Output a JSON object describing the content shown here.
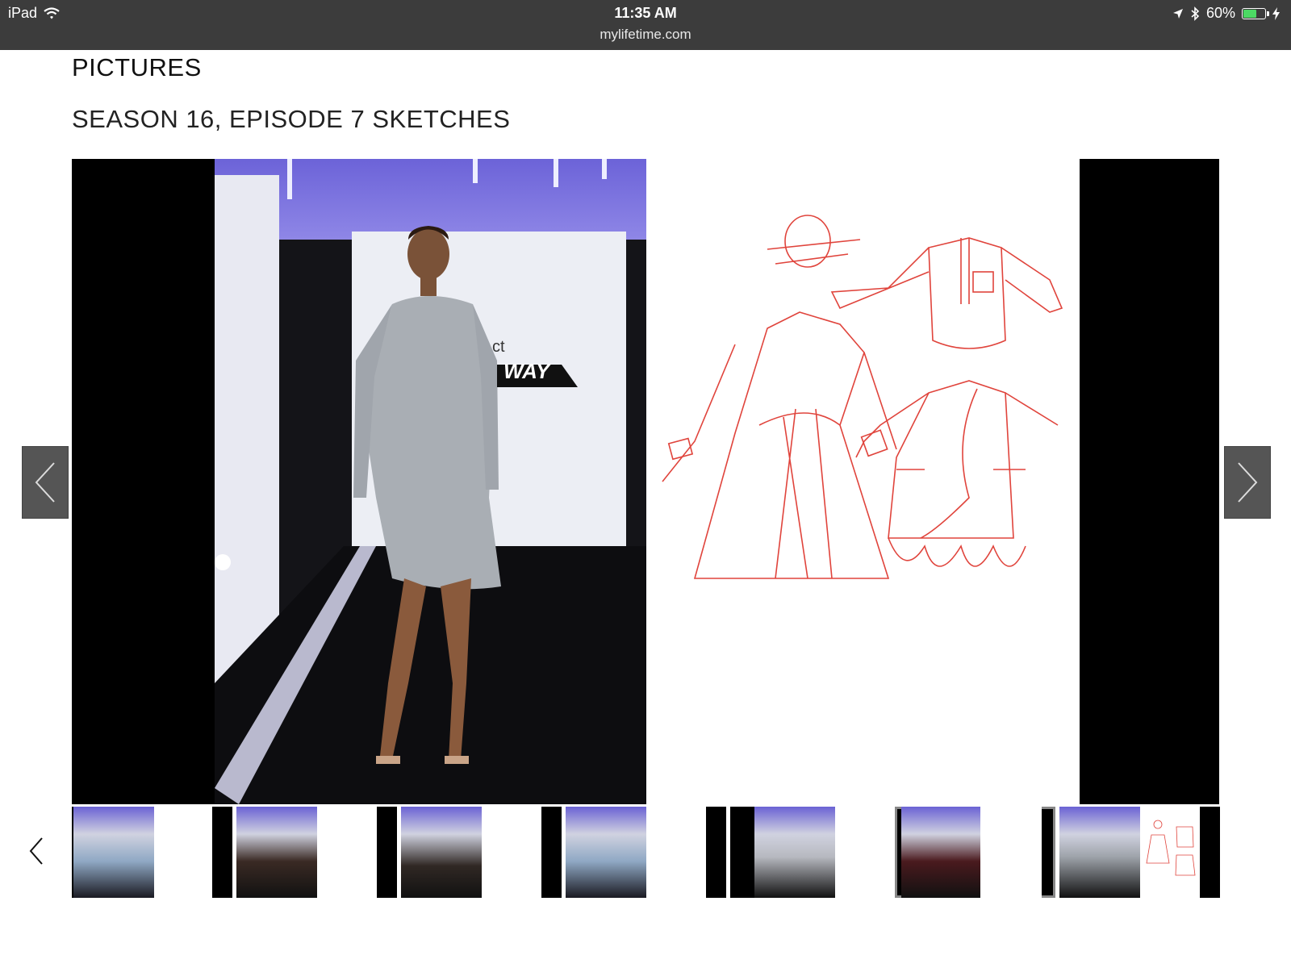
{
  "status_bar": {
    "device": "iPad",
    "time": "11:35 AM",
    "url": "mylifetime.com",
    "battery": "60%",
    "battery_level": 0.6,
    "icons": [
      "wifi-icon",
      "location-arrow-icon",
      "bluetooth-icon",
      "battery-icon",
      "charging-icon"
    ]
  },
  "page": {
    "heading": "PICTURES",
    "subheading": "SEASON 16, EPISODE 7 SKETCHES"
  },
  "viewer": {
    "backdrop_sign": "WAY",
    "backdrop_sign_small": "ct",
    "prev_icon": "chevron-left-icon",
    "next_icon": "chevron-right-icon"
  },
  "thumbnails": {
    "prev_icon": "chevron-left-icon",
    "count": 7,
    "active_index": 5
  },
  "colors": {
    "status_bar_bg": "#3c3c3c",
    "battery_green": "#4cd964",
    "sketch_red": "#e0443c",
    "nav_button_bg": "#555555"
  }
}
